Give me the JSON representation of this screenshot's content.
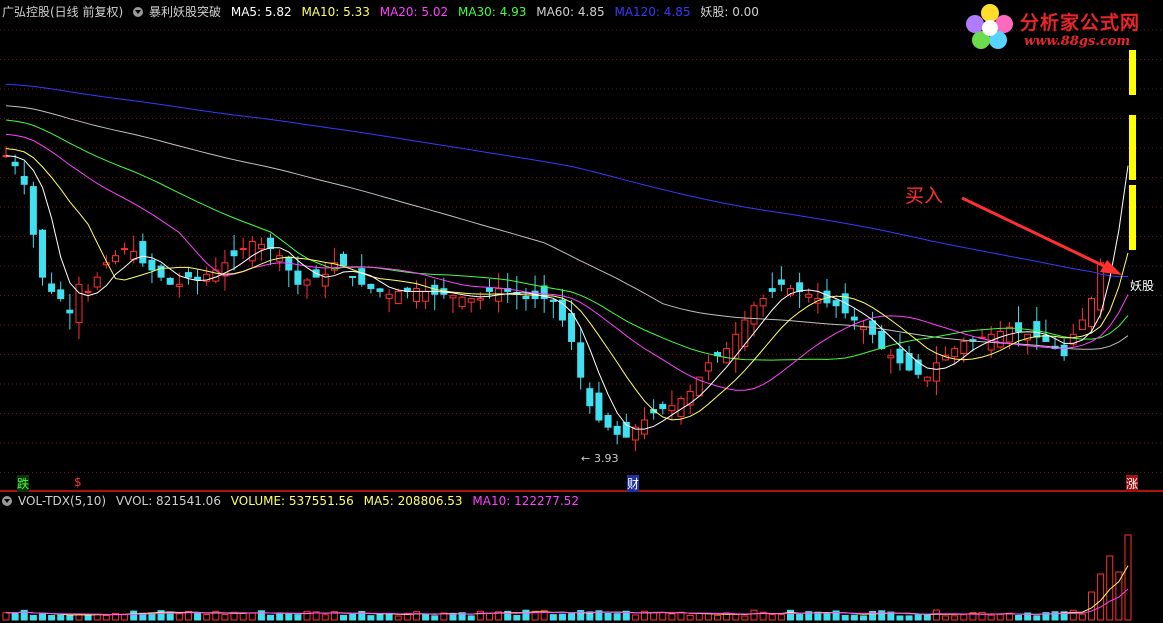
{
  "header": {
    "stock": "广弘控股(日线 前复权)",
    "indicator": "暴利妖股突破",
    "ma5": "MA5: 5.82",
    "ma10": "MA10: 5.33",
    "ma20": "MA20: 5.02",
    "ma30": "MA30: 4.93",
    "ma60": "MA60: 4.85",
    "ma120": "MA120: 4.85",
    "yaogu": "妖股: 0.00"
  },
  "vol_header": {
    "name": "VOL-TDX(5,10)",
    "vvol": "VVOL: 821541.06",
    "volume": "VOLUME: 537551.56",
    "ma5": "MA5: 208806.53",
    "ma10": "MA10: 122277.52"
  },
  "logo": {
    "title": "分析家公式网",
    "url": "www.88gs.com"
  },
  "annotations": {
    "buy": "买入",
    "yaogu_tag": "妖股",
    "low_price": "3.93",
    "event_die": "跌",
    "event_s": "$",
    "event_cai": "财",
    "event_zhang": "涨"
  },
  "colors": {
    "up": "#ff3030",
    "down": "#40e0f0",
    "ma5": "#ffffff",
    "ma10": "#ffff60",
    "ma20": "#ff40ff",
    "ma30": "#40ff40",
    "ma60": "#c0c0c0",
    "ma120": "#3838ff",
    "signal": "#ffff00",
    "grid": "#7a1010"
  },
  "chart_data": {
    "type": "candlestick",
    "series_close": [
      5.95,
      5.88,
      5.75,
      5.4,
      5.1,
      5.0,
      4.95,
      4.85,
      5.05,
      5.0,
      5.1,
      5.2,
      5.25,
      5.3,
      5.28,
      5.2,
      5.15,
      5.1,
      5.05,
      5.05,
      5.1,
      5.08,
      5.12,
      5.15,
      5.2,
      5.25,
      5.3,
      5.35,
      5.33,
      5.3,
      5.25,
      5.15,
      5.05,
      5.08,
      5.1,
      5.12,
      5.2,
      5.18,
      5.1,
      5.05,
      5.02,
      5.0,
      4.98,
      5.0,
      5.0,
      5.02,
      5.0,
      4.98,
      4.98,
      4.97,
      4.96,
      4.95,
      4.95,
      5.0,
      5.02,
      5.0,
      4.98,
      4.95,
      4.95,
      4.95,
      4.93,
      4.8,
      4.65,
      4.4,
      4.2,
      4.1,
      4.05,
      4.0,
      3.98,
      4.05,
      4.1,
      4.15,
      4.18,
      4.2,
      4.25,
      4.3,
      4.4,
      4.5,
      4.55,
      4.6,
      4.7,
      4.8,
      4.9,
      4.95,
      5.0,
      5.05,
      5.02,
      5.0,
      4.98,
      4.95,
      4.92,
      4.9,
      4.85,
      4.8,
      4.75,
      4.7,
      4.6,
      4.55,
      4.5,
      4.45,
      4.42,
      4.4,
      4.5,
      4.55,
      4.6,
      4.65,
      4.65,
      4.68,
      4.7,
      4.72,
      4.75,
      4.72,
      4.7,
      4.68,
      4.65,
      4.6,
      4.55,
      4.7,
      4.8,
      4.95,
      5.2,
      5.8,
      6.4,
      7.05
    ],
    "low_point": 3.93
  }
}
